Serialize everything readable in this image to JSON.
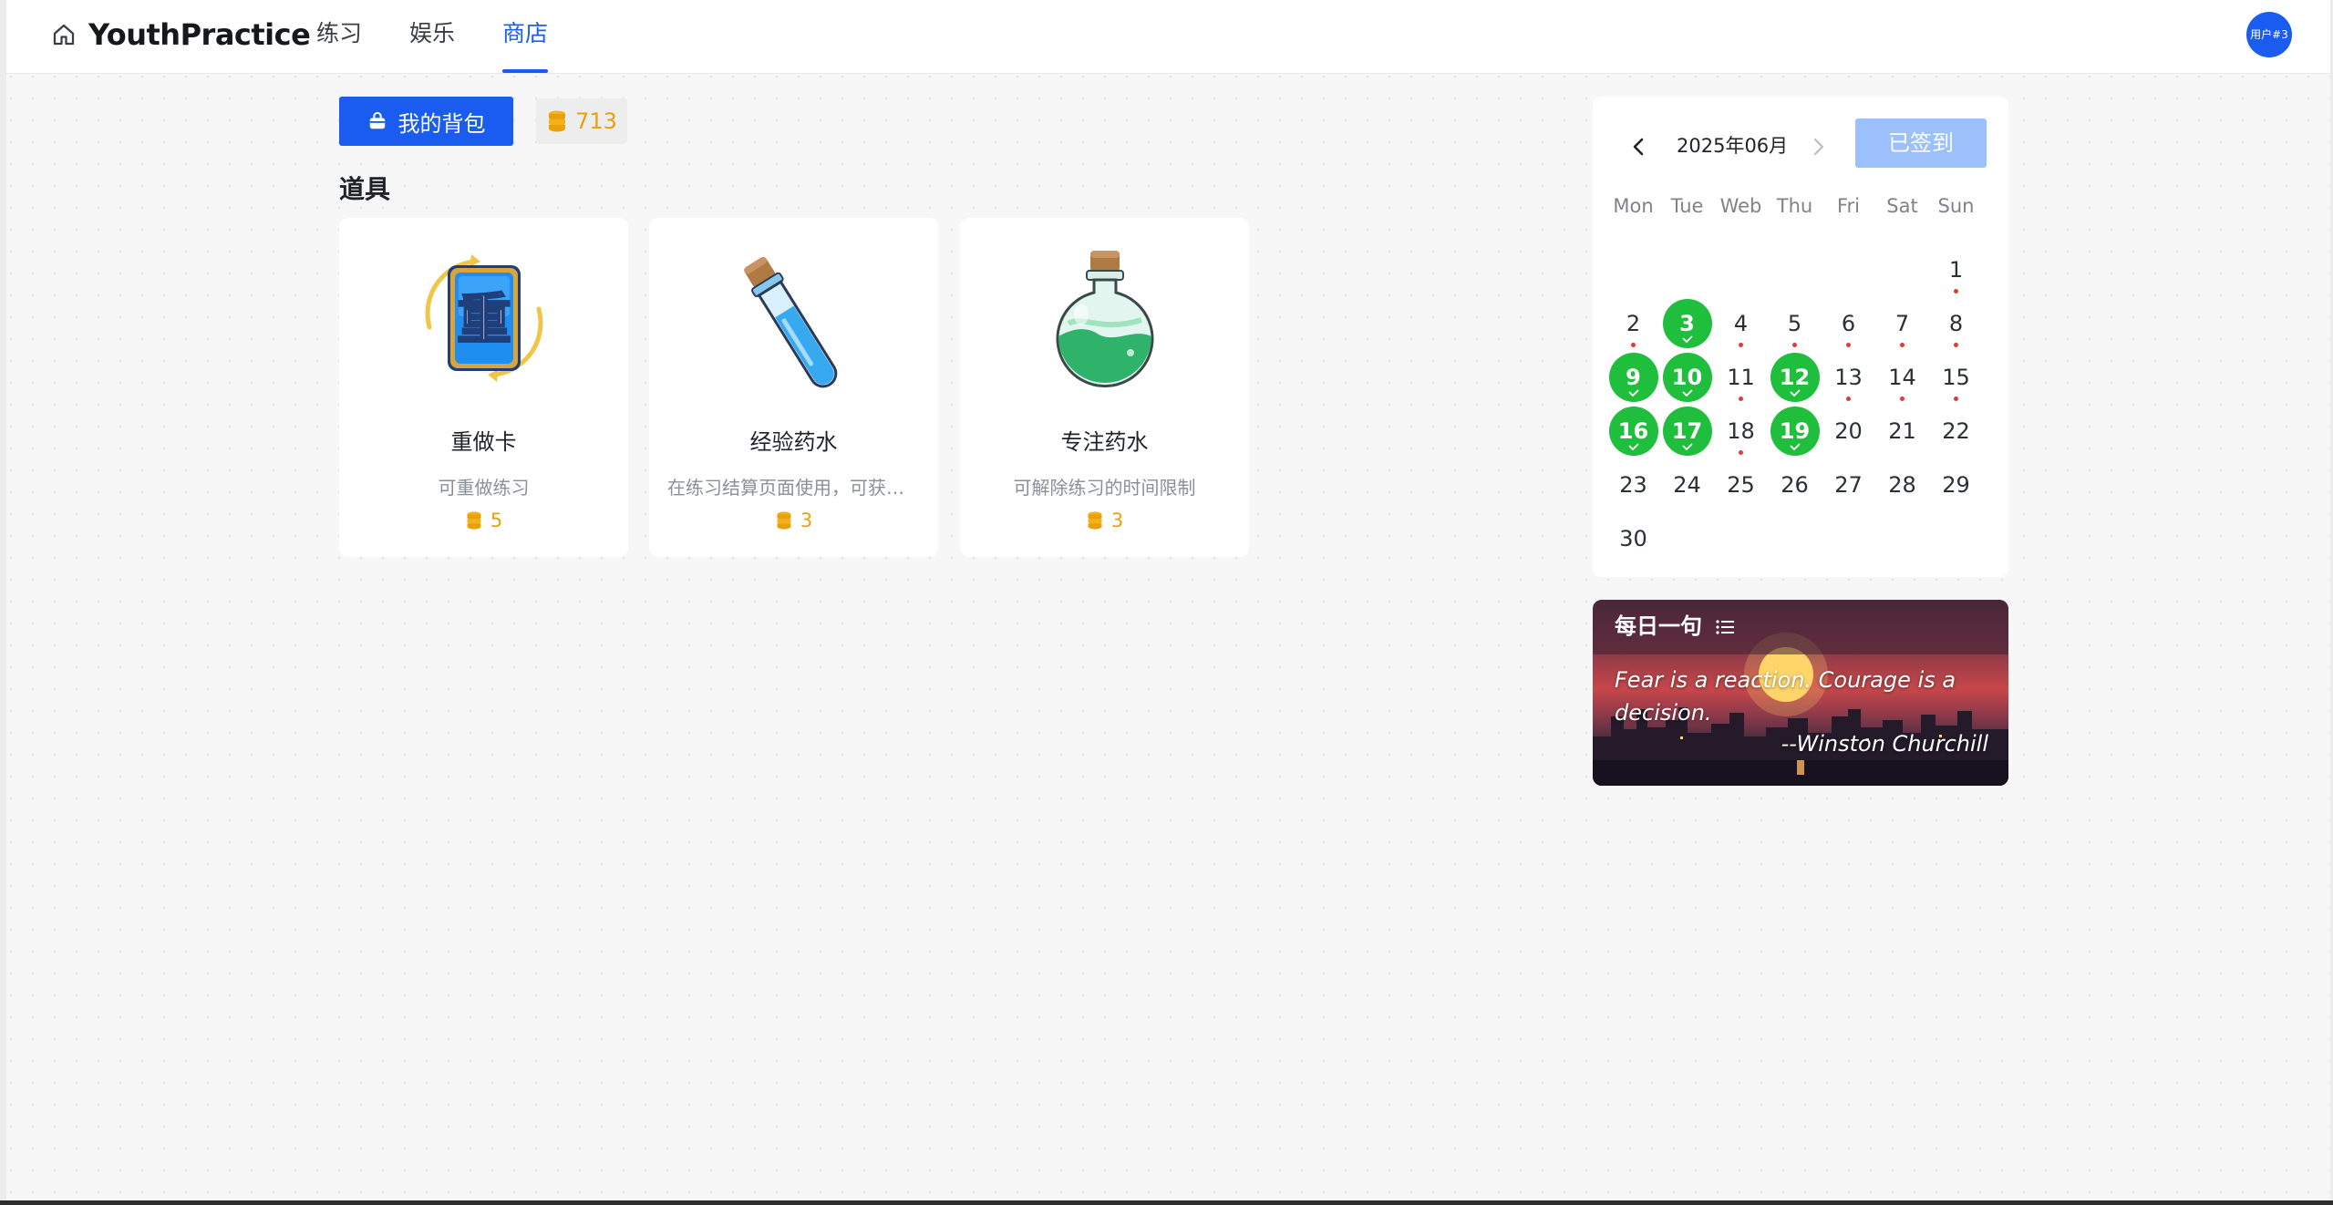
{
  "header": {
    "brand": "YouthPractice",
    "nav": [
      {
        "label": "练习",
        "active": false
      },
      {
        "label": "娱乐",
        "active": false
      },
      {
        "label": "商店",
        "active": true
      }
    ],
    "avatar_label": "用户#3",
    "accent_color": "#1a5cf0"
  },
  "toolbar": {
    "bag_label": "我的背包",
    "coins": "713"
  },
  "items_section": {
    "title": "道具",
    "items": [
      {
        "name": "重做卡",
        "desc": "可重做练习",
        "price": "5",
        "icon": "redo-card-icon",
        "card_glyph": "重"
      },
      {
        "name": "经验药水",
        "desc": "在练习结算页面使用，可获得双倍经验",
        "price": "3",
        "icon": "exp-potion-icon"
      },
      {
        "name": "专注药水",
        "desc": "可解除练习的时间限制",
        "price": "3",
        "icon": "focus-potion-icon"
      }
    ]
  },
  "calendar": {
    "month": "2025年06月",
    "sign_label": "已签到",
    "weekdays": [
      "Mon",
      "Tue",
      "Web",
      "Thu",
      "Fri",
      "Sat",
      "Sun"
    ],
    "days": [
      "1",
      "2",
      "3",
      "4",
      "5",
      "6",
      "7",
      "8",
      "9",
      "10",
      "11",
      "12",
      "13",
      "14",
      "15",
      "16",
      "17",
      "18",
      "19",
      "20",
      "21",
      "22",
      "23",
      "24",
      "25",
      "26",
      "27",
      "28",
      "29",
      "30"
    ],
    "signed_days": [
      3,
      9,
      10,
      12,
      16,
      17,
      19
    ],
    "marked_days": [
      1,
      2,
      4,
      5,
      6,
      7,
      8,
      11,
      13,
      14,
      15,
      18
    ],
    "signed_color": "#1fbe3c",
    "mark_color": "#e53935"
  },
  "quote": {
    "title": "每日一句",
    "text": "Fear is a reaction. Courage is a decision.",
    "author": "--Winston Churchill"
  }
}
